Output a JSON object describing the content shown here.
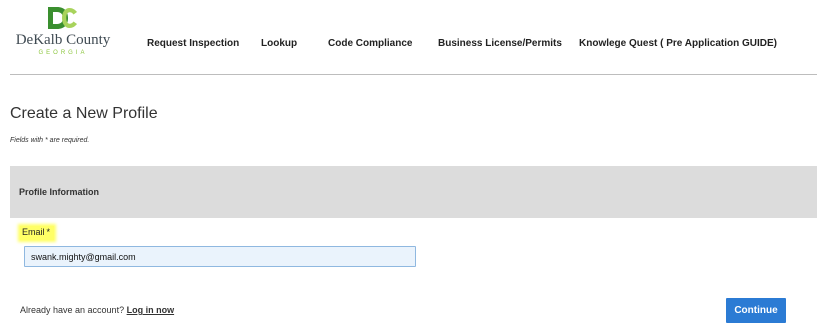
{
  "brand": {
    "name": "DeKalb County",
    "state": "GEORGIA",
    "logo_letters": "DC",
    "logo_color_dark": "#3a8f2f",
    "logo_color_light": "#a8d35c"
  },
  "nav": {
    "items": [
      {
        "label": "Request Inspection"
      },
      {
        "label": "Lookup"
      },
      {
        "label": "Code Compliance"
      },
      {
        "label": "Business License/Permits"
      },
      {
        "label": "Knowlege Quest ( Pre Application GUIDE)"
      }
    ]
  },
  "page": {
    "title": "Create a New Profile",
    "required_note": "Fields with * are required."
  },
  "section": {
    "title": "Profile Information"
  },
  "form": {
    "email_label": "Email",
    "required_marker": "*",
    "email_value": "swank.mighty@gmail.com"
  },
  "footer": {
    "account_prompt": "Already have an account?",
    "login_label": "Log in now",
    "continue_label": "Continue"
  },
  "colors": {
    "accent": "#2b7bd4",
    "highlight": "#ffff66",
    "section_bg": "#dcdcdc"
  }
}
